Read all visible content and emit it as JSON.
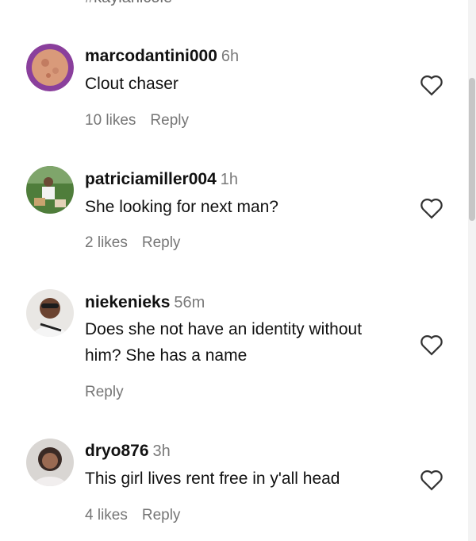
{
  "cut_text": "#kaylanicole",
  "comments": [
    {
      "username": "marcodantini000",
      "time": "6h",
      "text": "Clout chaser",
      "likes": "10 likes",
      "reply": "Reply",
      "avatar": "moon-avatar"
    },
    {
      "username": "patriciamiller004",
      "time": "1h",
      "text": "She looking for next man?",
      "likes": "2 likes",
      "reply": "Reply",
      "avatar": "outdoor-photo-avatar"
    },
    {
      "username": "niekenieks",
      "time": "56m",
      "text": "Does she not have an identity without him? She has a name",
      "likes": "",
      "reply": "Reply",
      "avatar": "selfie-avatar"
    },
    {
      "username": "dryo876",
      "time": "3h",
      "text": "This girl lives rent free in y'all head",
      "likes": "4 likes",
      "reply": "Reply",
      "avatar": "portrait-avatar"
    }
  ],
  "icons": {
    "like": "heart-outline-icon"
  },
  "colors": {
    "username": "#111111",
    "muted": "#767676",
    "background": "#ffffff"
  }
}
